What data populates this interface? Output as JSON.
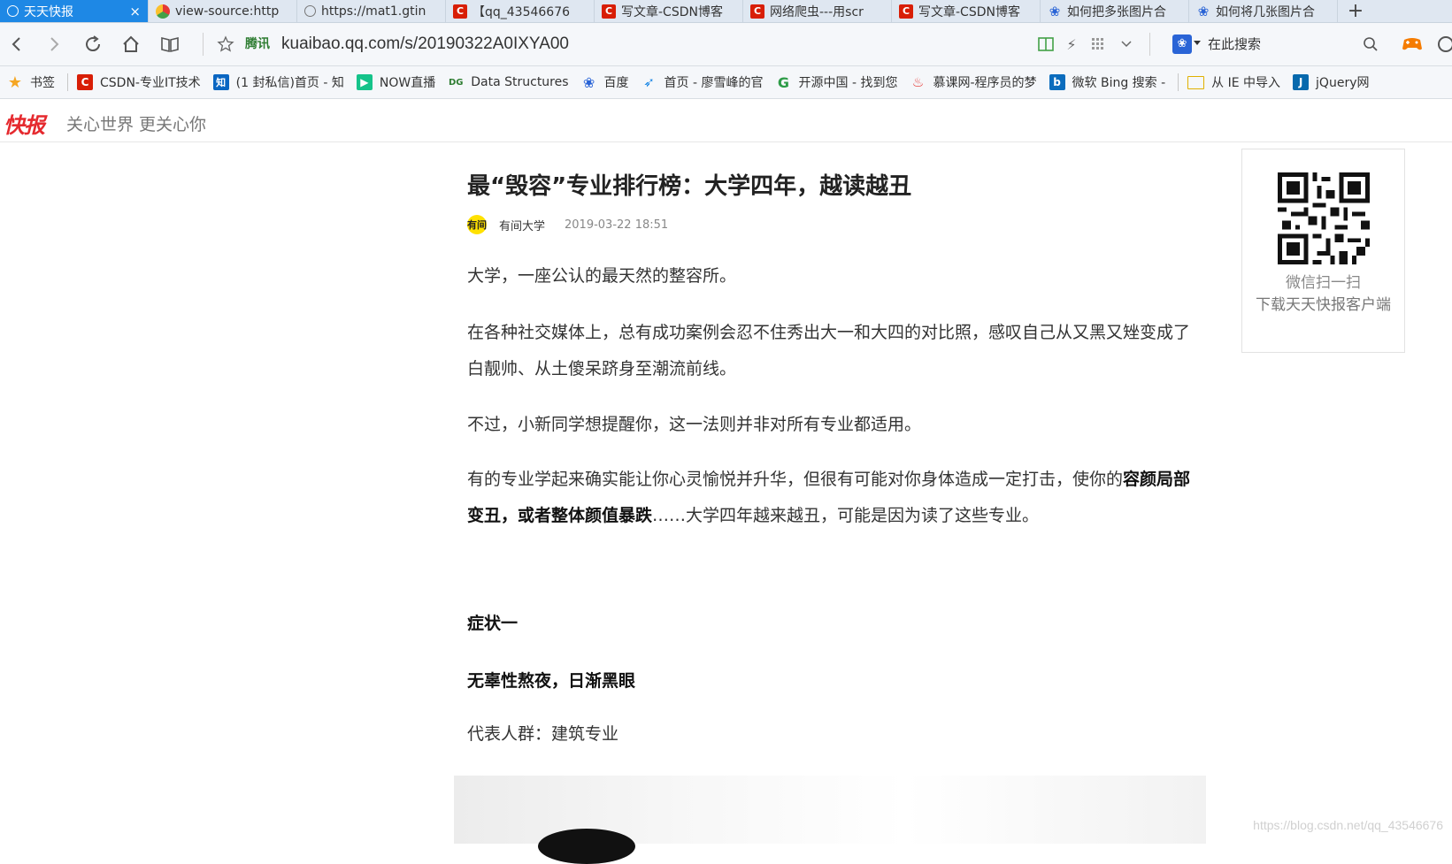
{
  "browser": {
    "tabs": [
      {
        "title": "天天快报",
        "active": true,
        "icon": "globe-icon"
      },
      {
        "title": "view-source:http",
        "icon": "source-icon"
      },
      {
        "title": "https://mat1.gtin",
        "icon": "globe-icon"
      },
      {
        "title": "【qq_43546676",
        "icon": "csdn-icon"
      },
      {
        "title": "写文章-CSDN博客",
        "icon": "csdn-icon"
      },
      {
        "title": "网络爬虫---用scr",
        "icon": "csdn-icon"
      },
      {
        "title": "写文章-CSDN博客",
        "icon": "csdn-icon"
      },
      {
        "title": "如何把多张图片合",
        "icon": "baidu-paw-icon"
      },
      {
        "title": "如何将几张图片合",
        "icon": "baidu-paw-icon"
      }
    ],
    "tab_close": "×",
    "new_tab": "+",
    "url_site_label": "腾讯",
    "url": "kuaibao.qq.com/s/20190322A0IXYA00",
    "search_placeholder": "在此搜索",
    "bookmarks": [
      {
        "label": "书签",
        "icon": "star-icon"
      },
      {
        "label": "CSDN-专业IT技术",
        "icon": "csdn-icon"
      },
      {
        "label": "(1 封私信)首页 - 知",
        "icon": "zhihu-icon"
      },
      {
        "label": "NOW直播",
        "icon": "now-icon"
      },
      {
        "label": "Data Structures",
        "icon": "dg-icon"
      },
      {
        "label": "百度",
        "icon": "baidu-paw-icon"
      },
      {
        "label": "首页 - 廖雪峰的官",
        "icon": "rocket-icon"
      },
      {
        "label": "开源中国 - 找到您",
        "icon": "oschina-icon"
      },
      {
        "label": "慕课网-程序员的梦",
        "icon": "flame-icon"
      },
      {
        "label": "微软 Bing 搜索 -",
        "icon": "bing-icon"
      },
      {
        "label": "从 IE 中导入",
        "icon": "folder-icon"
      },
      {
        "label": "jQuery网",
        "icon": "jquery-icon"
      }
    ],
    "colors": {
      "active_tab": "#1e88e5",
      "csdn_red": "#d81e06"
    }
  },
  "site": {
    "logo": "快报",
    "slogan": "关心世界 更关心你"
  },
  "article": {
    "title": "最“毁容”专业排行榜：大学四年，越读越丑",
    "author_avatar_text": "有间",
    "author": "有间大学",
    "date": "2019-03-22 18:51",
    "p1": "大学，一座公认的最天然的整容所。",
    "p2": "在各种社交媒体上，总有成功案例会忍不住秀出大一和大四的对比照，感叹自己从又黑又矬变成了白靓帅、从土傻呆跻身至潮流前线。",
    "p3": "不过，小新同学想提醒你，这一法则并非对所有专业都适用。",
    "p4a": "有的专业学起来确实能让你心灵愉悦并升华，但很有可能对你身体造成一定打击，使你的",
    "p4b": "容颜局部变丑，或者整体颜值暴跌",
    "p4c": "……大学四年越来越丑，可能是因为读了这些专业。",
    "h1": "症状一",
    "h2": "无辜性熬夜，日渐黑眼",
    "p5": "代表人群：建筑专业"
  },
  "qr_panel": {
    "line1": "微信扫一扫",
    "line2": "下载天天快报客户端"
  },
  "watermark": "https://blog.csdn.net/qq_43546676"
}
